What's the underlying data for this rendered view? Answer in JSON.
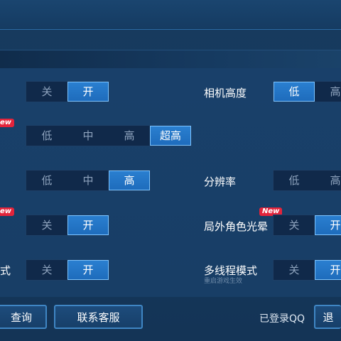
{
  "settings": {
    "row1": {
      "left_options": [
        "关",
        "开"
      ],
      "right_label": "相机高度",
      "right_options": [
        "低",
        "高"
      ]
    },
    "row2": {
      "badge": "ew",
      "left_options": [
        "低",
        "中",
        "高",
        "超高"
      ]
    },
    "row3": {
      "left_options": [
        "低",
        "中",
        "高"
      ],
      "right_label": "分辨率",
      "right_options": [
        "低",
        "高"
      ]
    },
    "row4": {
      "badge": "ew",
      "left_options": [
        "关",
        "开"
      ],
      "right_label": "局外角色光晕",
      "right_badge": "New",
      "right_options": [
        "关",
        "开"
      ]
    },
    "row5": {
      "left_label_tail": "式",
      "left_options": [
        "关",
        "开"
      ],
      "right_label": "多线程模式",
      "right_sublabel": "重启游戏生效",
      "right_options": [
        "关",
        "开"
      ]
    }
  },
  "footer": {
    "query_button": "查询",
    "service_button": "联系客服",
    "login_status": "已登录QQ",
    "logout_button": "退"
  }
}
